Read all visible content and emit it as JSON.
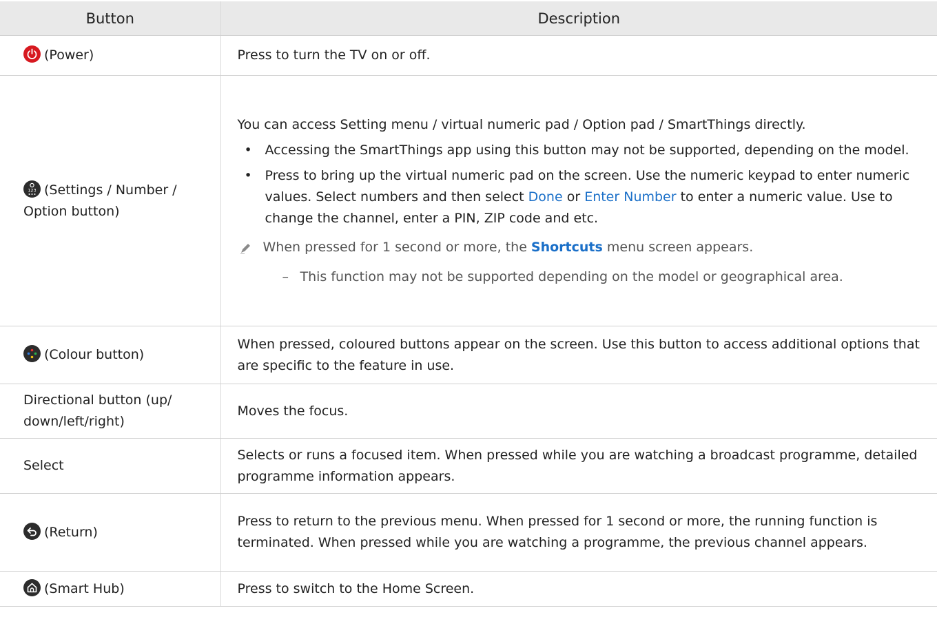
{
  "header": {
    "col1": "Button",
    "col2": "Description"
  },
  "rows": {
    "power": {
      "label": "(Power)",
      "desc": "Press to turn the TV on or off."
    },
    "settings": {
      "label": "(Settings / Number / Option button)",
      "intro": "You can access Setting menu / virtual numeric pad / Option pad / SmartThings directly.",
      "bullet1": "Accessing the SmartThings app using this button may not be supported, depending on the model.",
      "bullet2_a": "Press to bring up the virtual numeric pad on the screen. Use the numeric keypad to enter numeric values. Select numbers and then select ",
      "bullet2_done": "Done",
      "bullet2_or": " or ",
      "bullet2_enter": "Enter Number",
      "bullet2_b": " to enter a numeric value. Use to change the channel, enter a PIN, ZIP code and etc.",
      "note_a": "When pressed for 1 second or more, the ",
      "note_shortcuts": "Shortcuts",
      "note_b": " menu screen appears.",
      "subnote": "This function may not be supported depending on the model or geographical area."
    },
    "colour": {
      "label": "(Colour button)",
      "desc": "When pressed, coloured buttons appear on the screen. Use this button to access additional options that are specific to the feature in use."
    },
    "directional": {
      "label": "Directional button (up/ down/left/right)",
      "desc": "Moves the focus."
    },
    "select": {
      "label": "Select",
      "desc": "Selects or runs a focused item. When pressed while you are watching a broadcast programme, detailed programme information appears."
    },
    "return": {
      "label": "(Return)",
      "desc": "Press to return to the previous menu. When pressed for 1 second or more, the running function is terminated. When pressed while you are watching a programme, the previous channel appears."
    },
    "smarthub": {
      "label": "(Smart Hub)",
      "desc": "Press to switch to the Home Screen."
    }
  },
  "icons": {
    "power": "power-icon",
    "settings": "settings-number-icon",
    "colour": "colour-button-icon",
    "return": "return-icon",
    "smarthub": "home-icon",
    "note": "pencil-icon"
  },
  "colors": {
    "power_red": "#d71920",
    "highlight_blue": "#1a6fc8",
    "header_bg": "#e9e9e9"
  }
}
